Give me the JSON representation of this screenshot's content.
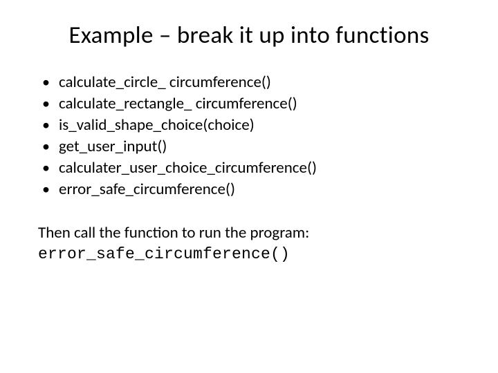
{
  "title": "Example – break it up into functions",
  "bullets": [
    "calculate_circle_ circumference()",
    "calculate_rectangle_ circumference()",
    "is_valid_shape_choice(choice)",
    "get_user_input()",
    "calculater_user_choice_circumference()",
    "error_safe_circumference()"
  ],
  "body_text": "Then call the function to run the program:",
  "code_call": "error_safe_circumference()"
}
